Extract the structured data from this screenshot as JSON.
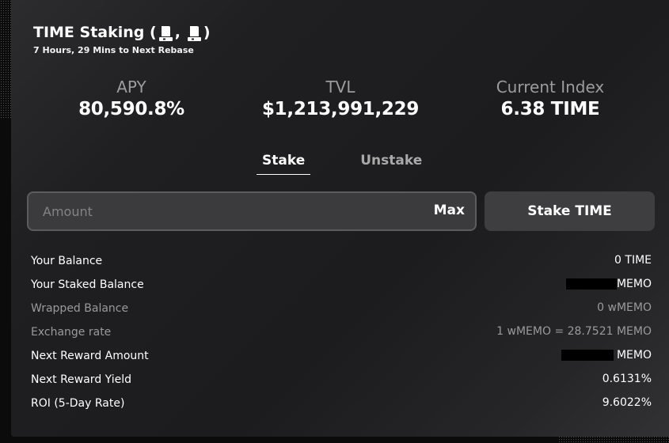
{
  "header": {
    "title": "TIME Staking (",
    "title_sep": ",",
    "title_end": ")",
    "subtitle": "7 Hours, 29 Mins to Next Rebase"
  },
  "stats": {
    "apy": {
      "label": "APY",
      "value": "80,590.8%"
    },
    "tvl": {
      "label": "TVL",
      "value": "$1,213,991,229"
    },
    "index": {
      "label": "Current Index",
      "value": "6.38 TIME"
    }
  },
  "tabs": {
    "stake": "Stake",
    "unstake": "Unstake",
    "active": "stake"
  },
  "form": {
    "amount_placeholder": "Amount",
    "amount_value": "",
    "max_label": "Max",
    "stake_button_label": "Stake TIME"
  },
  "details": {
    "your_balance": {
      "label": "Your Balance",
      "value": "0 TIME"
    },
    "staked_balance": {
      "label": "Your Staked Balance",
      "value_suffix": "MEMO"
    },
    "wrapped_balance": {
      "label": "Wrapped Balance",
      "value": "0 wMEMO"
    },
    "exchange_rate": {
      "label": "Exchange rate",
      "value": "1 wMEMO = 28.7521 MEMO"
    },
    "next_reward_amount": {
      "label": "Next Reward Amount",
      "value_suffix": "MEMO"
    },
    "next_reward_yield": {
      "label": "Next Reward Yield",
      "value": "0.6131%"
    },
    "roi": {
      "label": "ROI (5-Day Rate)",
      "value": "9.6022%"
    }
  },
  "icons": {
    "title_icon_1": "time-token-icon",
    "title_icon_2": "memo-token-icon"
  },
  "colors": {
    "background": "#0b0b0c",
    "card": "#1f1f21",
    "text": "#ffffff",
    "muted": "#9a9a9a",
    "input_bg": "#3b3b3d",
    "button_bg": "#3e3e40"
  }
}
